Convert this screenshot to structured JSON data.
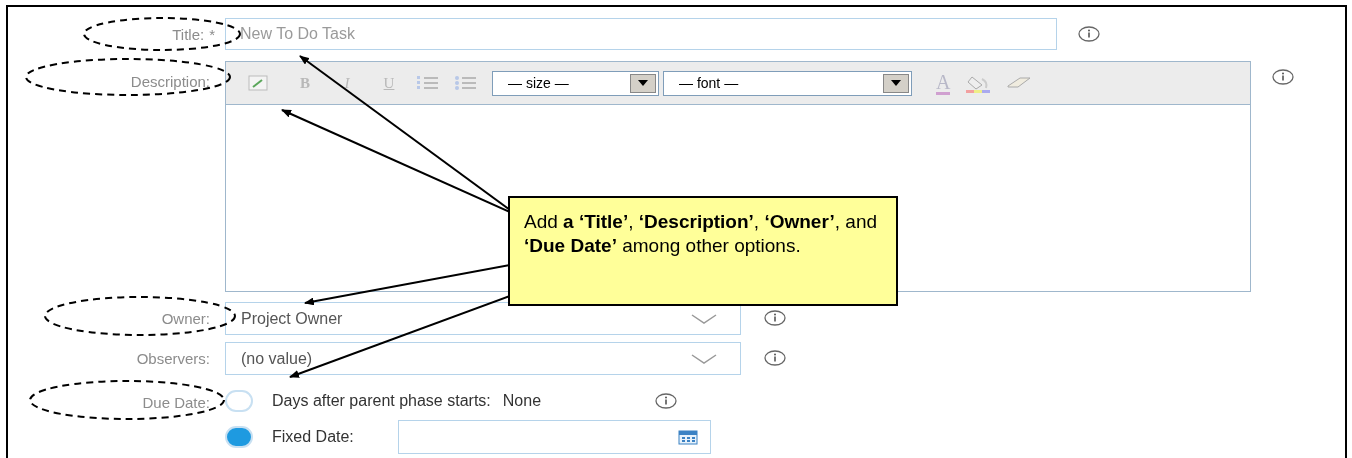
{
  "title_field": {
    "label": "Title:",
    "required_mark": "*",
    "placeholder": "New To Do Task"
  },
  "description": {
    "label": "Description:",
    "format_buttons": [
      "B",
      "I",
      "U"
    ],
    "size_select": "— size —",
    "font_select": "— font —",
    "text_color_button": "A"
  },
  "owner": {
    "label": "Owner:",
    "value": "Project Owner"
  },
  "observers": {
    "label": "Observers:",
    "value": "(no value)"
  },
  "due_date": {
    "label": "Due Date:",
    "options": [
      {
        "kind": "days",
        "label": "Days after parent phase starts:",
        "value": "None",
        "selected": false
      },
      {
        "kind": "fixed",
        "label": "Fixed Date:",
        "selected": true
      }
    ]
  },
  "callout": {
    "text": "Add **a ‘Title’**, **‘Description’**, **‘Owner’**, and **‘Due Date’** among other options."
  }
}
